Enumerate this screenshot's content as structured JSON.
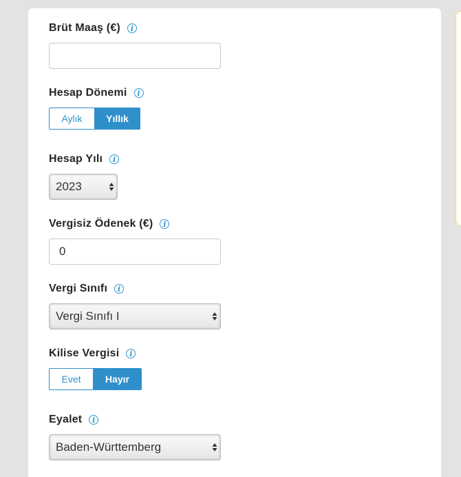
{
  "form": {
    "gross_salary": {
      "label": "Brüt Maaş (€)",
      "value": ""
    },
    "period": {
      "label": "Hesap Dönemi",
      "options": [
        "Aylık",
        "Yıllık"
      ],
      "selected": "Yıllık"
    },
    "year": {
      "label": "Hesap Yılı",
      "value": "2023"
    },
    "tax_free_allowance": {
      "label": "Vergisiz Ödenek (€)",
      "value": "0"
    },
    "tax_class": {
      "label": "Vergi Sınıfı",
      "value": "Vergi Sınıfı I"
    },
    "church_tax": {
      "label": "Kilise Vergisi",
      "options": [
        "Evet",
        "Hayır"
      ],
      "selected": "Hayır"
    },
    "state": {
      "label": "Eyalet",
      "value": "Baden-Württemberg"
    }
  },
  "icons": {
    "info": "info-icon",
    "select_arrows": "sort-arrows-icon"
  },
  "colors": {
    "accent": "#2f8fcb",
    "info": "#3097d1",
    "page_bg": "#e3e3e3",
    "side_panel_border": "#f2dc86"
  }
}
